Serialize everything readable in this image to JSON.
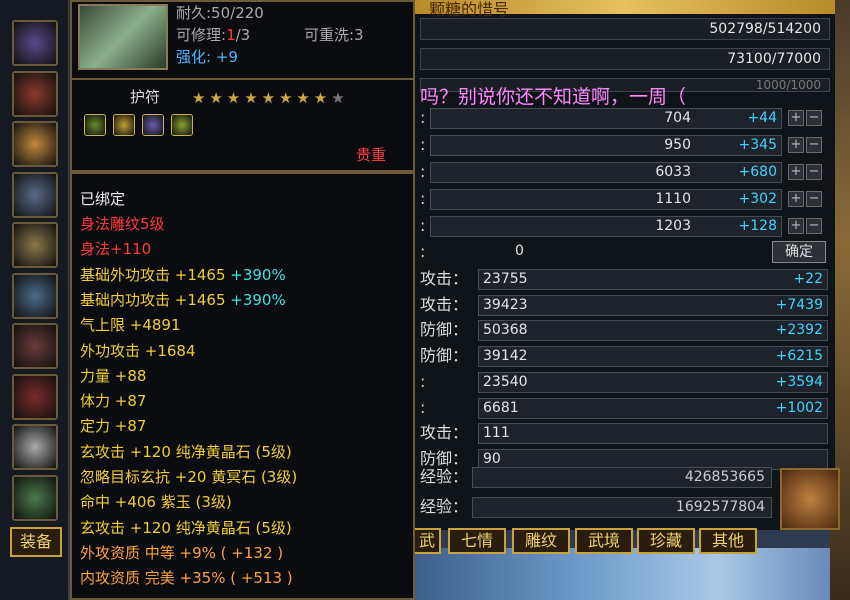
{
  "colors": {
    "accent_gold": "#c9a23a",
    "bonus_blue": "#3fd4ff",
    "tooltip_yellow": "#f0cc3a",
    "tooltip_red": "#ff3a3a",
    "stat_cyan": "#3fe0e0"
  },
  "header": {
    "title_fragment": "颗糖的惜号"
  },
  "marquee": {
    "text": "吗？别说你还不知道啊，一周（"
  },
  "top_bars": [
    {
      "value": "502798/514200"
    },
    {
      "value": "73100/77000"
    },
    {
      "value": "1000/1000"
    }
  ],
  "attributes": [
    {
      "label": ":",
      "value": "704",
      "bonus": "+44"
    },
    {
      "label": ":",
      "value": "950",
      "bonus": "+345"
    },
    {
      "label": ":",
      "value": "6033",
      "bonus": "+680"
    },
    {
      "label": ":",
      "value": "1110",
      "bonus": "+302"
    },
    {
      "label": ":",
      "value": "1203",
      "bonus": "+128"
    }
  ],
  "points_row": {
    "label": ":",
    "value": "0",
    "confirm": "确定"
  },
  "combat_stats": [
    {
      "label": "攻击：",
      "value": "23755",
      "bonus": "+22"
    },
    {
      "label": "攻击：",
      "value": "39423",
      "bonus": "+7439"
    },
    {
      "label": "防御：",
      "value": "50368",
      "bonus": "+2392"
    },
    {
      "label": "防御：",
      "value": "39142",
      "bonus": "+6215"
    },
    {
      "label": ":",
      "value": "23540",
      "bonus": "+3594"
    },
    {
      "label": ":",
      "value": "6681",
      "bonus": "+1002"
    },
    {
      "label": "攻击：",
      "value": "111",
      "bonus": ""
    },
    {
      "label": "防御：",
      "value": "90",
      "bonus": ""
    }
  ],
  "experience": [
    {
      "label": "经验：",
      "value": "426853665"
    },
    {
      "label": "经验：",
      "value": "1692577804"
    }
  ],
  "tabs": [
    "武",
    "七情",
    "雕纹",
    "武境",
    "珍藏",
    "其他"
  ],
  "equip_tab": "装备",
  "tooltip": {
    "durability": "耐久:50/220",
    "repair_label": "可修理:",
    "repair_cur": "1",
    "repair_max": "/3",
    "rewash": "可重洗:3",
    "enhance_label": "强化:",
    "enhance_value": "+9",
    "type": "护符",
    "stars_filled": 8,
    "stars_total": 9,
    "precious": "贵重",
    "bound": "已绑定",
    "lines": [
      {
        "text": "身法雕纹5级",
        "color": "red"
      },
      {
        "text": "身法+110",
        "color": "red"
      },
      {
        "text": "基础外功攻击 +1465 ",
        "extra": "+390%",
        "color": "yel"
      },
      {
        "text": "基础内功攻击 +1465 ",
        "extra": "+390%",
        "color": "yel"
      },
      {
        "text": "气上限 +4891",
        "color": "yel"
      },
      {
        "text": "外功攻击 +1684",
        "color": "yel"
      },
      {
        "text": "力量 +88",
        "color": "yel"
      },
      {
        "text": "体力 +87",
        "color": "yel"
      },
      {
        "text": "定力 +87",
        "color": "yel"
      },
      {
        "text": "玄攻击 +120 纯净黄晶石 (5级)",
        "color": "yel"
      },
      {
        "text": "忽略目标玄抗 +20 黄冥石 (3级)",
        "color": "yel"
      },
      {
        "text": "命中 +406 紫玉 (3级)",
        "color": "yel"
      },
      {
        "text": "玄攻击 +120 纯净黄晶石 (5级)",
        "color": "yel"
      },
      {
        "text": "外攻资质  中等 +9% ( +132 )",
        "color": "orange"
      },
      {
        "text": "内攻资质  完美 +35% ( +513 )",
        "color": "orange"
      }
    ]
  },
  "icons": [
    "amulet-icon",
    "gem-green-icon",
    "gem-gold-icon",
    "gem-purple-icon",
    "gem-lime-icon",
    "dragon-head-icon"
  ]
}
